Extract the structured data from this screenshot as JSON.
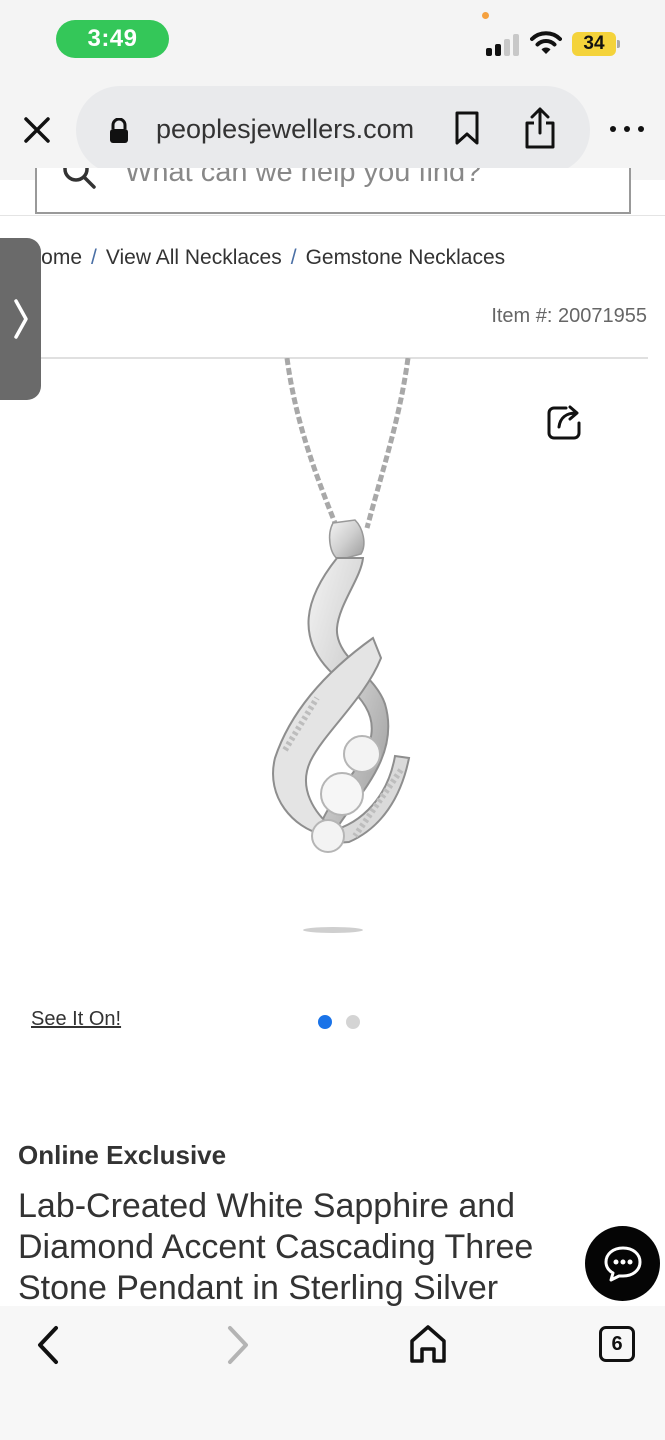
{
  "status_bar": {
    "time": "3:49",
    "battery": "34",
    "icons": [
      "signal-icon",
      "wifi-icon",
      "battery-icon"
    ]
  },
  "browser": {
    "url": "peoplesjewellers.com",
    "icons": [
      "close-icon",
      "lock-icon",
      "bookmark-icon",
      "share-icon",
      "more-icon"
    ]
  },
  "search": {
    "placeholder": "What can we help you find?"
  },
  "breadcrumb": {
    "items": [
      "Home",
      "View All Necklaces",
      "Gemstone Necklaces"
    ],
    "separator": "/"
  },
  "product": {
    "item_number": "Item #: 20071955",
    "see_it_on": "See It On!",
    "carousel": {
      "total": 2,
      "active": 1
    },
    "badge": "Online Exclusive",
    "title": "Lab-Created White Sapphire and Diamond Accent Cascading Three Stone Pendant in Sterling Silver"
  },
  "bottom_nav": {
    "tab_count": "6",
    "icons": [
      "back-icon",
      "forward-icon",
      "home-icon",
      "tabs-icon"
    ]
  },
  "colors": {
    "time_pill": "#34c759",
    "battery": "#f4d33b",
    "active_dot": "#1a73e8",
    "chat_button": "#050505"
  }
}
